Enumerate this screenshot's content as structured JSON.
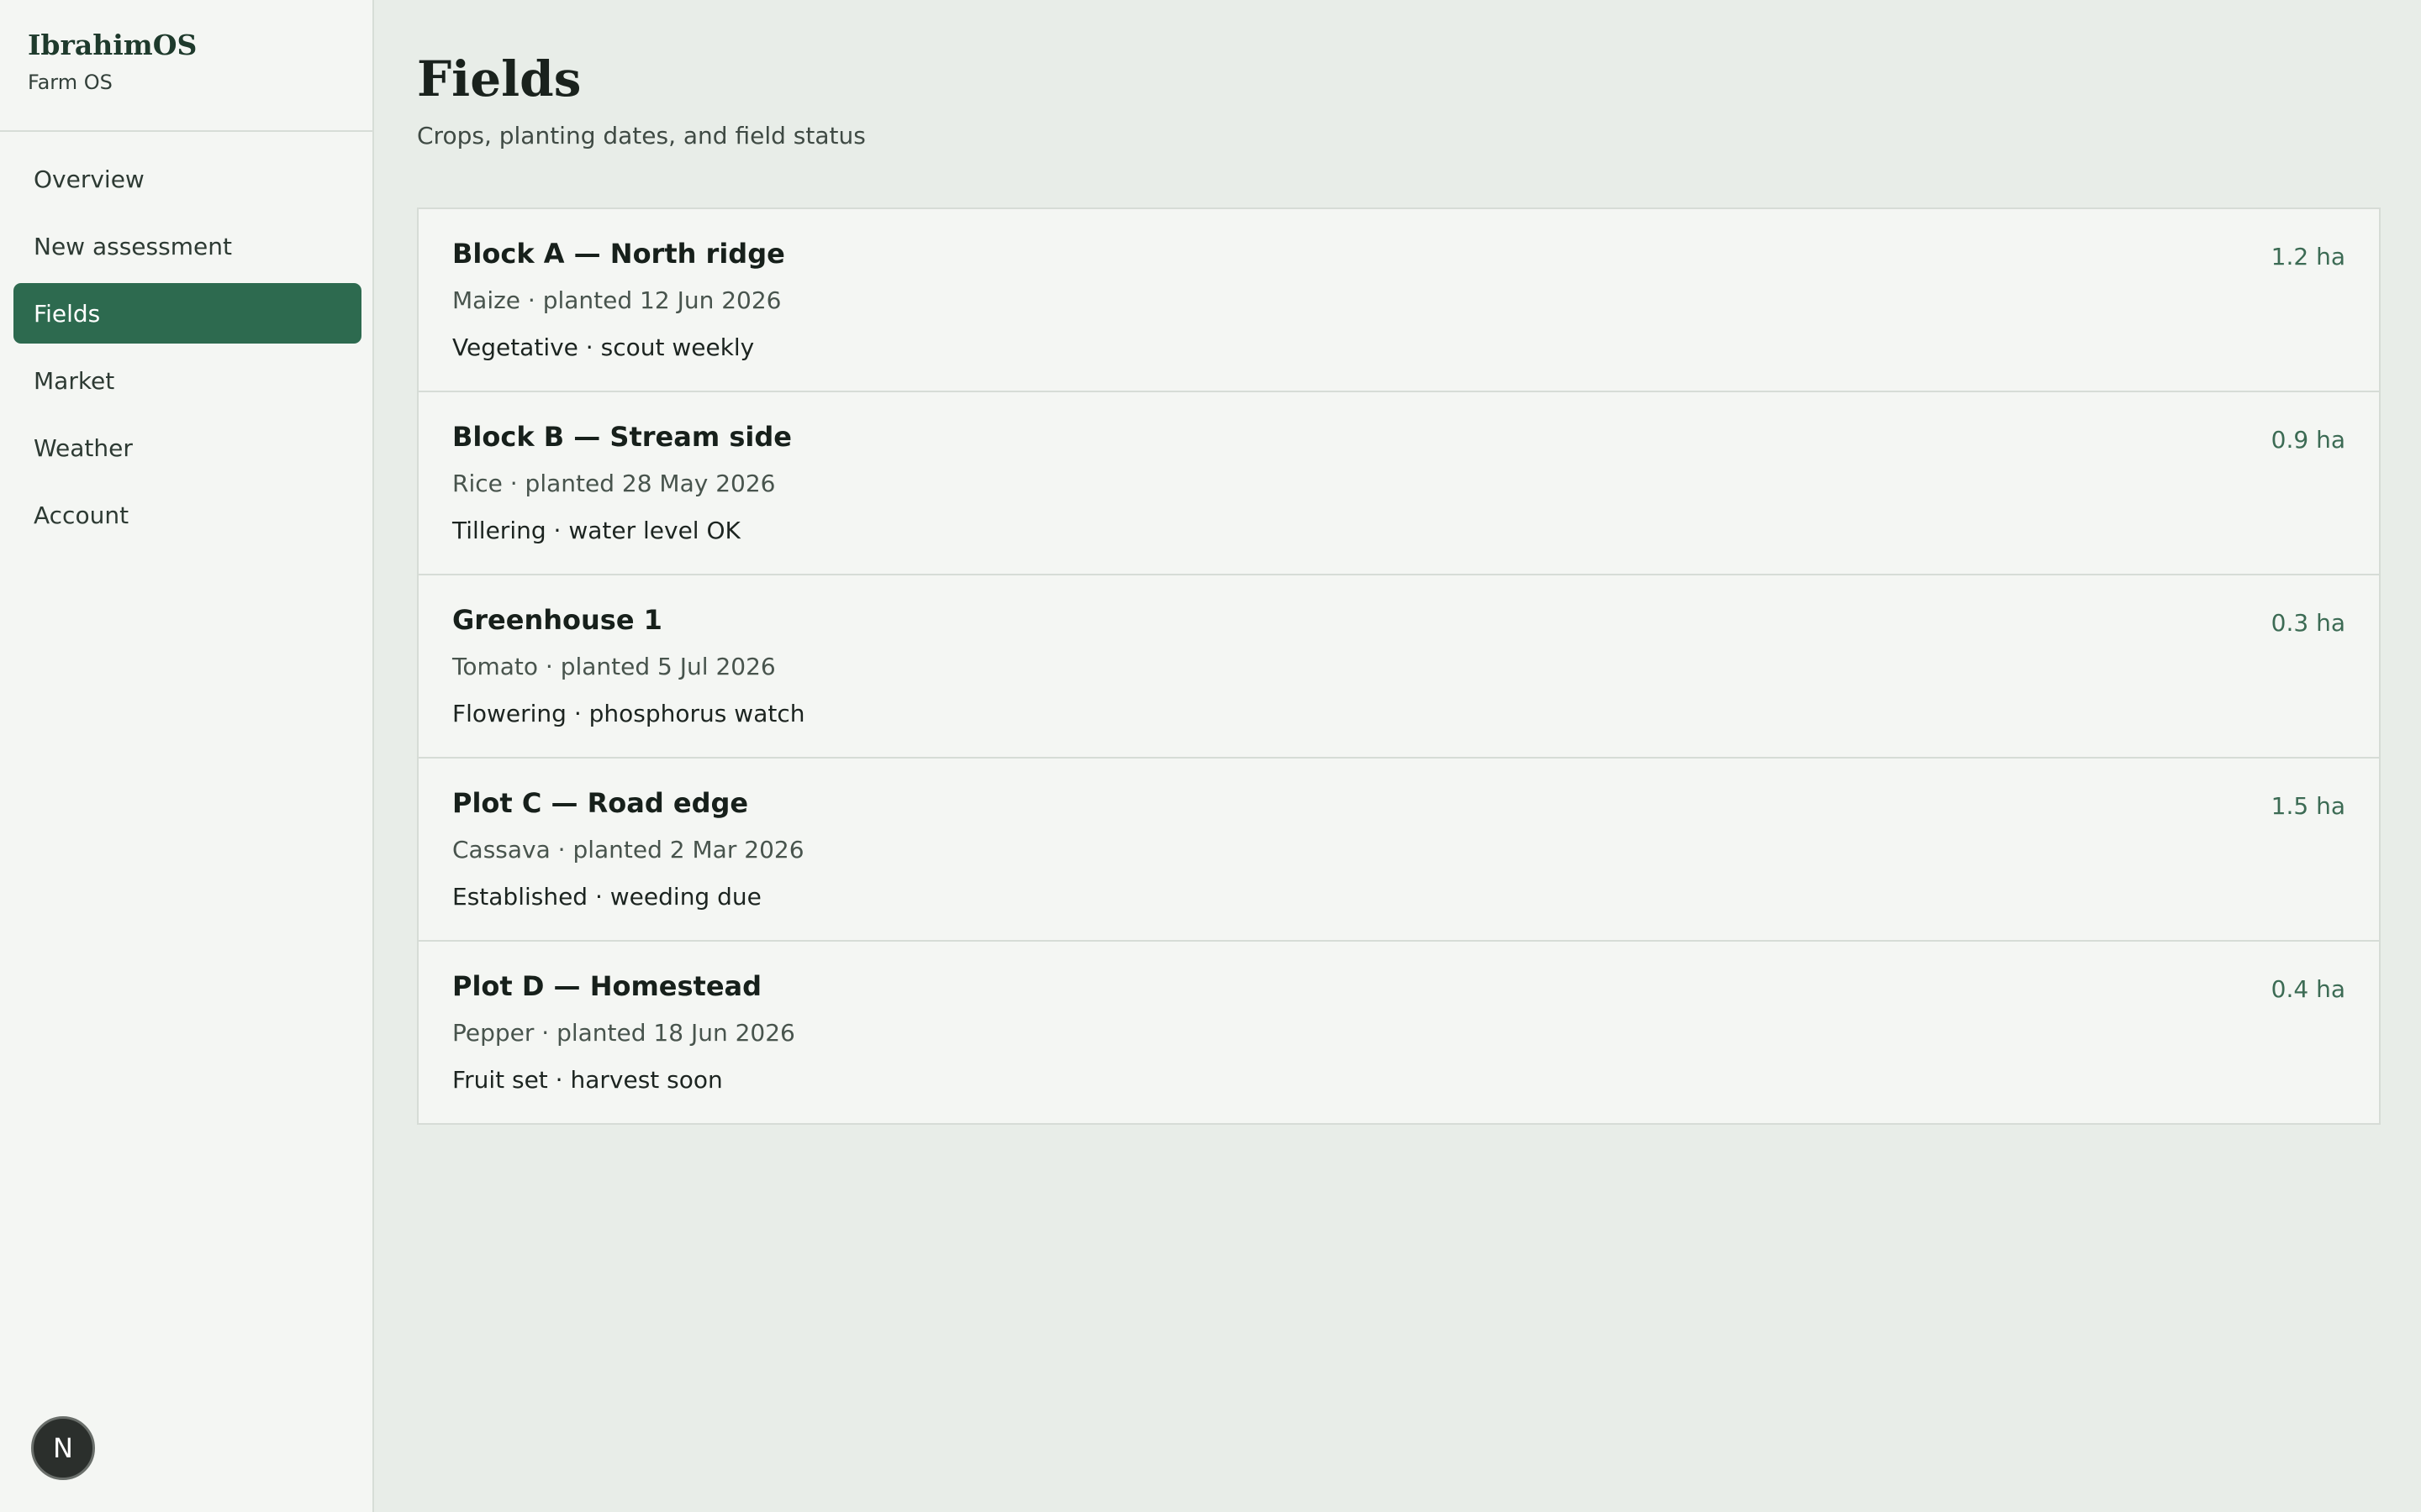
{
  "app": {
    "name": "IbrahimOS",
    "subtitle": "Farm OS"
  },
  "sidebar": {
    "items": [
      {
        "label": "Overview",
        "active": false
      },
      {
        "label": "New assessment",
        "active": false
      },
      {
        "label": "Fields",
        "active": true
      },
      {
        "label": "Market",
        "active": false
      },
      {
        "label": "Weather",
        "active": false
      },
      {
        "label": "Account",
        "active": false
      }
    ],
    "avatar_initial": "N"
  },
  "page": {
    "title": "Fields",
    "subtitle": "Crops, planting dates, and field status"
  },
  "fields": [
    {
      "name": "Block A — North ridge",
      "meta": "Maize · planted 12 Jun 2026",
      "status": "Vegetative · scout weekly",
      "area": "1.2 ha"
    },
    {
      "name": "Block B — Stream side",
      "meta": "Rice · planted 28 May 2026",
      "status": "Tillering · water level OK",
      "area": "0.9 ha"
    },
    {
      "name": "Greenhouse 1",
      "meta": "Tomato · planted 5 Jul 2026",
      "status": "Flowering · phosphorus watch",
      "area": "0.3 ha"
    },
    {
      "name": "Plot C — Road edge",
      "meta": "Cassava · planted 2 Mar 2026",
      "status": "Established · weeding due",
      "area": "1.5 ha"
    },
    {
      "name": "Plot D — Homestead",
      "meta": "Pepper · planted 18 Jun 2026",
      "status": "Fruit set · harvest soon",
      "area": "0.4 ha"
    }
  ],
  "colors": {
    "accent": "#2d6a4f",
    "background": "#e8ede8",
    "sidebar": "#f4f6f3"
  }
}
